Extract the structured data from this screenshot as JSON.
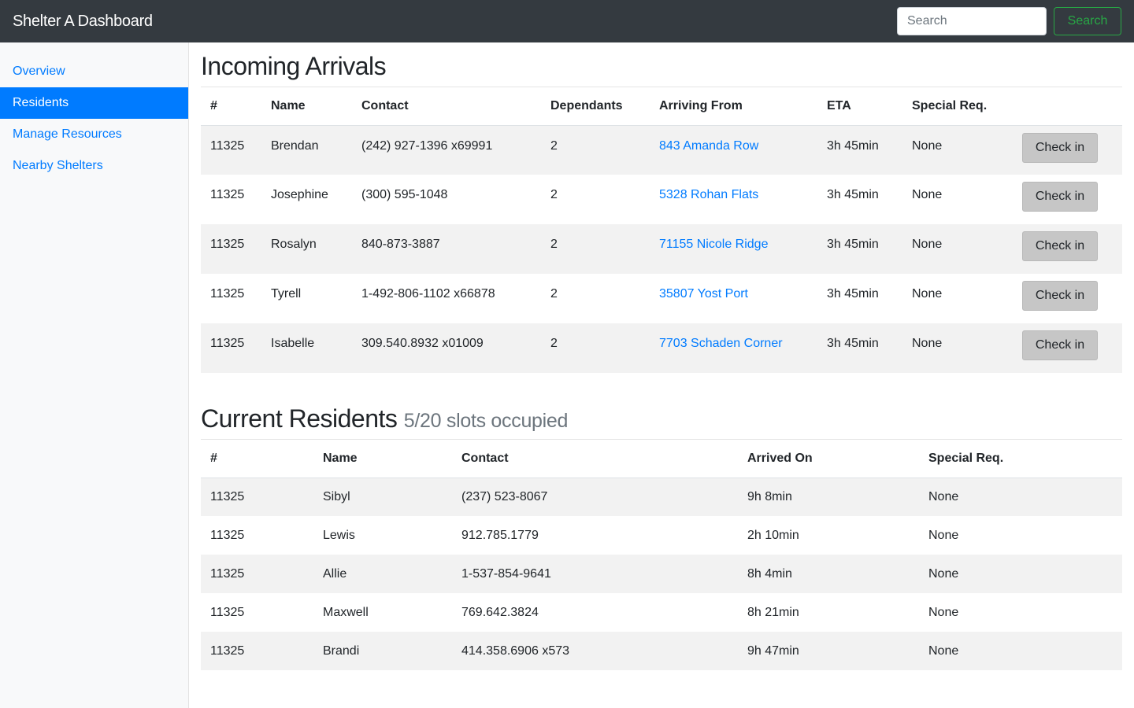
{
  "navbar": {
    "brand": "Shelter A Dashboard",
    "search_placeholder": "Search",
    "search_button": "Search"
  },
  "sidebar": {
    "items": [
      {
        "label": "Overview",
        "active": false
      },
      {
        "label": "Residents",
        "active": true
      },
      {
        "label": "Manage Resources",
        "active": false
      },
      {
        "label": "Nearby Shelters",
        "active": false
      }
    ]
  },
  "arrivals": {
    "title": "Incoming Arrivals",
    "headers": [
      "#",
      "Name",
      "Contact",
      "Dependants",
      "Arriving From",
      "ETA",
      "Special Req."
    ],
    "check_in_label": "Check in",
    "rows": [
      {
        "id": "11325",
        "name": "Brendan",
        "contact": "(242) 927-1396 x69991",
        "dependants": "2",
        "from": "843 Amanda Row",
        "eta": "3h 45min",
        "special": "None"
      },
      {
        "id": "11325",
        "name": "Josephine",
        "contact": "(300) 595-1048",
        "dependants": "2",
        "from": "5328 Rohan Flats",
        "eta": "3h 45min",
        "special": "None"
      },
      {
        "id": "11325",
        "name": "Rosalyn",
        "contact": "840-873-3887",
        "dependants": "2",
        "from": "71155 Nicole Ridge",
        "eta": "3h 45min",
        "special": "None"
      },
      {
        "id": "11325",
        "name": "Tyrell",
        "contact": "1-492-806-1102 x66878",
        "dependants": "2",
        "from": "35807 Yost Port",
        "eta": "3h 45min",
        "special": "None"
      },
      {
        "id": "11325",
        "name": "Isabelle",
        "contact": "309.540.8932 x01009",
        "dependants": "2",
        "from": "7703 Schaden Corner",
        "eta": "3h 45min",
        "special": "None"
      }
    ]
  },
  "residents": {
    "title": "Current Residents",
    "subtitle": "5/20 slots occupied",
    "headers": [
      "#",
      "Name",
      "Contact",
      "Arrived On",
      "Special Req."
    ],
    "rows": [
      {
        "id": "11325",
        "name": "Sibyl",
        "contact": "(237) 523-8067",
        "arrived": "9h 8min",
        "special": "None"
      },
      {
        "id": "11325",
        "name": "Lewis",
        "contact": "912.785.1779",
        "arrived": "2h 10min",
        "special": "None"
      },
      {
        "id": "11325",
        "name": "Allie",
        "contact": "1-537-854-9641",
        "arrived": "8h 4min",
        "special": "None"
      },
      {
        "id": "11325",
        "name": "Maxwell",
        "contact": "769.642.3824",
        "arrived": "8h 21min",
        "special": "None"
      },
      {
        "id": "11325",
        "name": "Brandi",
        "contact": "414.358.6906 x573",
        "arrived": "9h 47min",
        "special": "None"
      }
    ]
  },
  "colors": {
    "navbar_bg": "#343a40",
    "accent": "#007bff",
    "search_button": "#28a745",
    "check_in_button": "#c6c6c6"
  }
}
